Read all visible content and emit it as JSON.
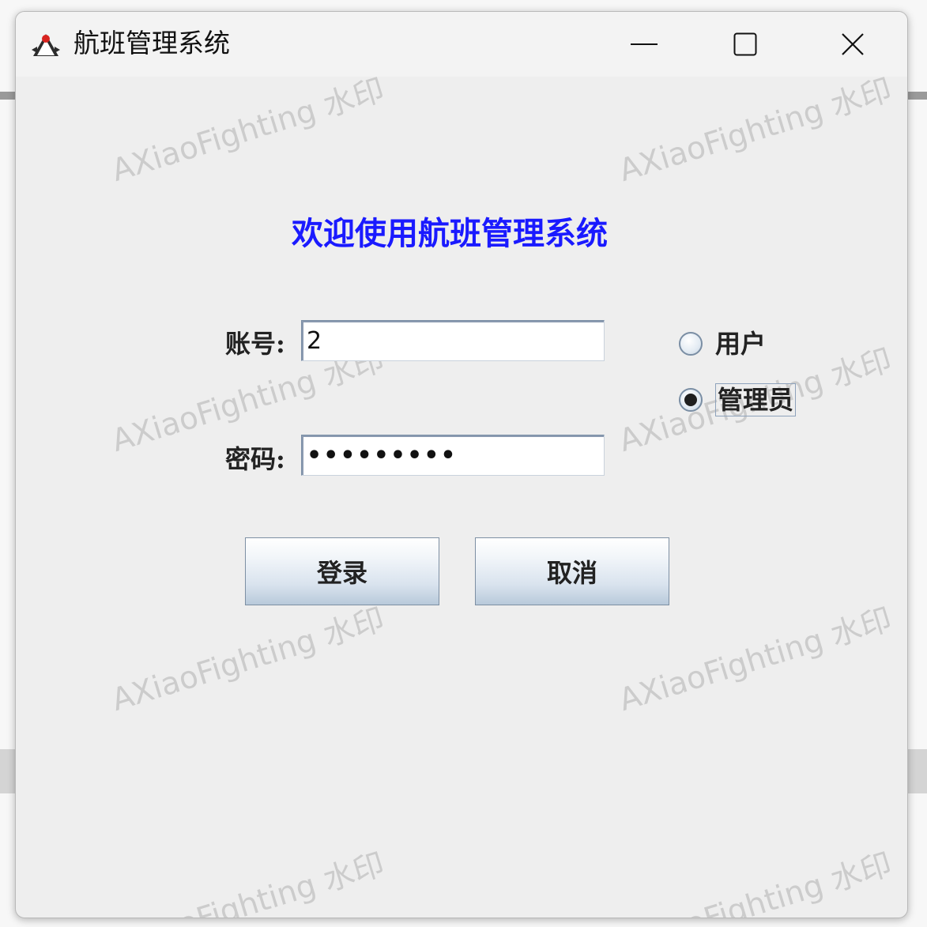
{
  "window": {
    "title": "航班管理系统",
    "icon": "java-duke-icon",
    "controls": {
      "minimize": "minimize-icon",
      "maximize": "maximize-icon",
      "close": "close-icon"
    }
  },
  "watermark_text": "AXiaoFighting 水印",
  "form": {
    "heading": "欢迎使用航班管理系统",
    "account_label": "账号:",
    "account_value": "2",
    "password_label": "密码:",
    "password_value": "•••••••••",
    "roles": [
      {
        "label": "用户",
        "checked": false
      },
      {
        "label": "管理员",
        "checked": true
      }
    ],
    "login_label": "登录",
    "cancel_label": "取消"
  },
  "colors": {
    "heading": "#1a1aff",
    "window_bg": "#eeeeee",
    "titlebar_bg": "#f3f3f3"
  }
}
